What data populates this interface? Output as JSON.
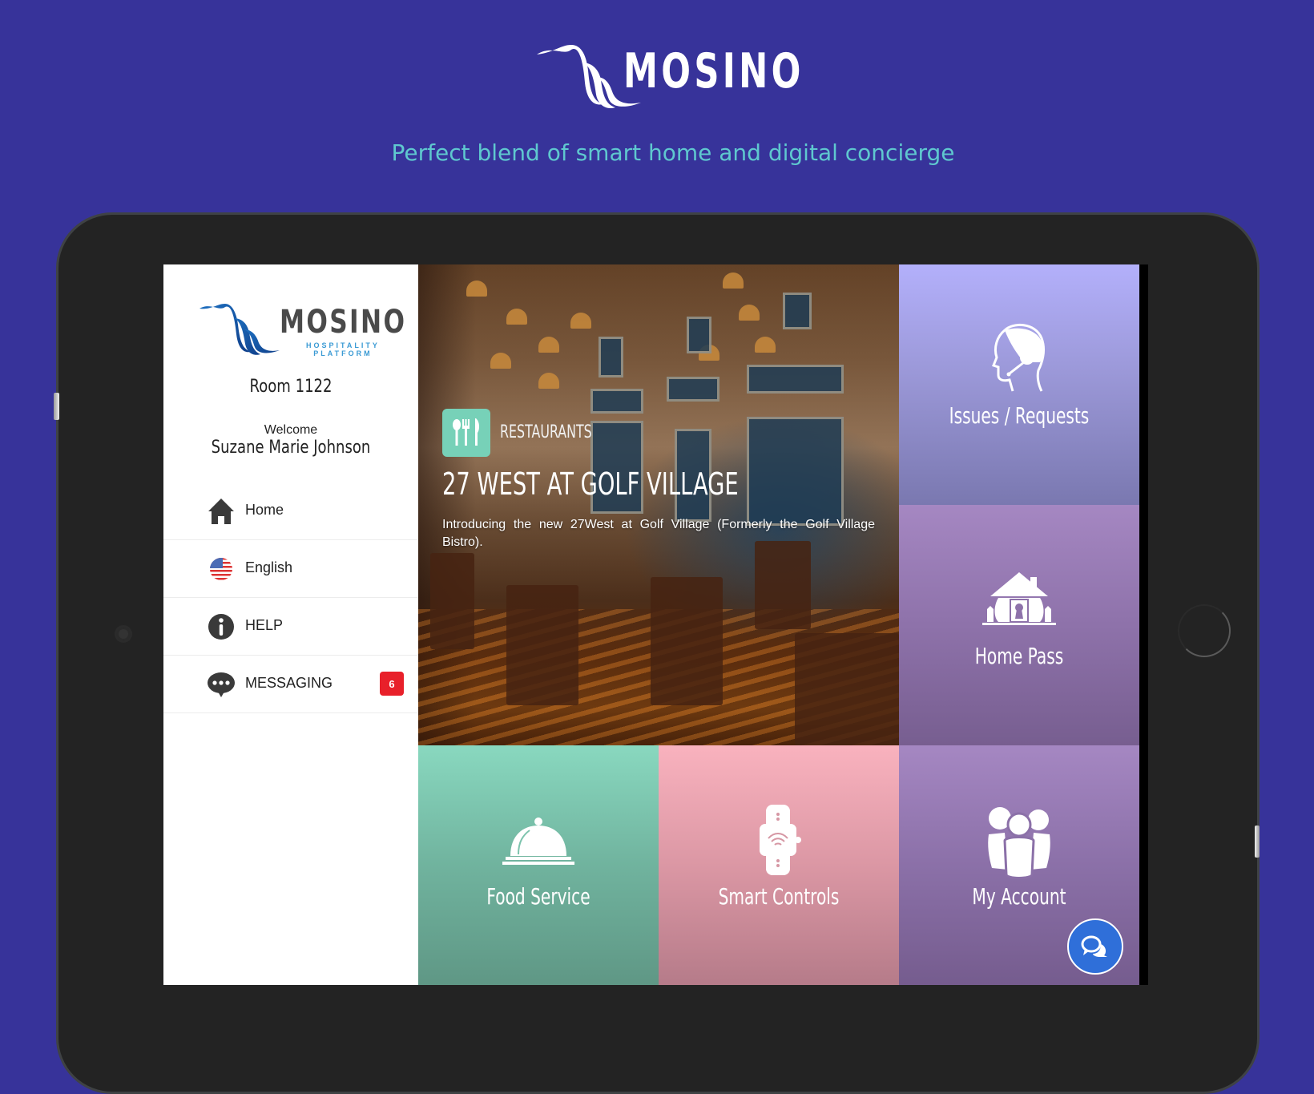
{
  "brand": {
    "name": "MOSINO",
    "tagline": "Perfect blend of smart home and digital concierge",
    "background_color": "#37339a",
    "tagline_color": "#5fc8cf"
  },
  "app": {
    "logo": {
      "name": "MOSINO",
      "subtitle_line1": "HOSPITALITY",
      "subtitle_line2": "PLATFORM"
    },
    "room": "Room 1122",
    "welcome": "Welcome",
    "guest_name": "Suzane Marie Johnson",
    "menu": [
      {
        "label": "Home",
        "icon": "home-icon"
      },
      {
        "label": "English",
        "icon": "us-flag-icon"
      },
      {
        "label": "HELP",
        "icon": "info-icon"
      },
      {
        "label": "MESSAGING",
        "icon": "chat-bubble-icon",
        "badge": "6"
      }
    ],
    "featured": {
      "category": "RESTAURANTS",
      "category_icon": "cutlery-icon",
      "title": "27 WEST AT GOLF VILLAGE",
      "description": "Introducing the new 27West at Golf Village (Formerly the Golf Village Bistro)."
    },
    "tiles": [
      {
        "label": "Issues / Requests",
        "icon": "headset-agent-icon",
        "color": "#b3b0fb"
      },
      {
        "label": "Home Pass",
        "icon": "house-keyhole-icon",
        "color": "#a587c2"
      },
      {
        "label": "Food Service",
        "icon": "cloche-icon",
        "color": "#89d8bf"
      },
      {
        "label": "Smart Controls",
        "icon": "smartwatch-wifi-icon",
        "color": "#f9b2be"
      },
      {
        "label": "My Account",
        "icon": "people-group-icon",
        "color": "#a587c2"
      }
    ],
    "chat_button": {
      "icon": "chat-bubbles-icon",
      "color": "#2f6fd9"
    },
    "badge_color": "#e8202a",
    "category_icon_color": "#77d1b8"
  }
}
